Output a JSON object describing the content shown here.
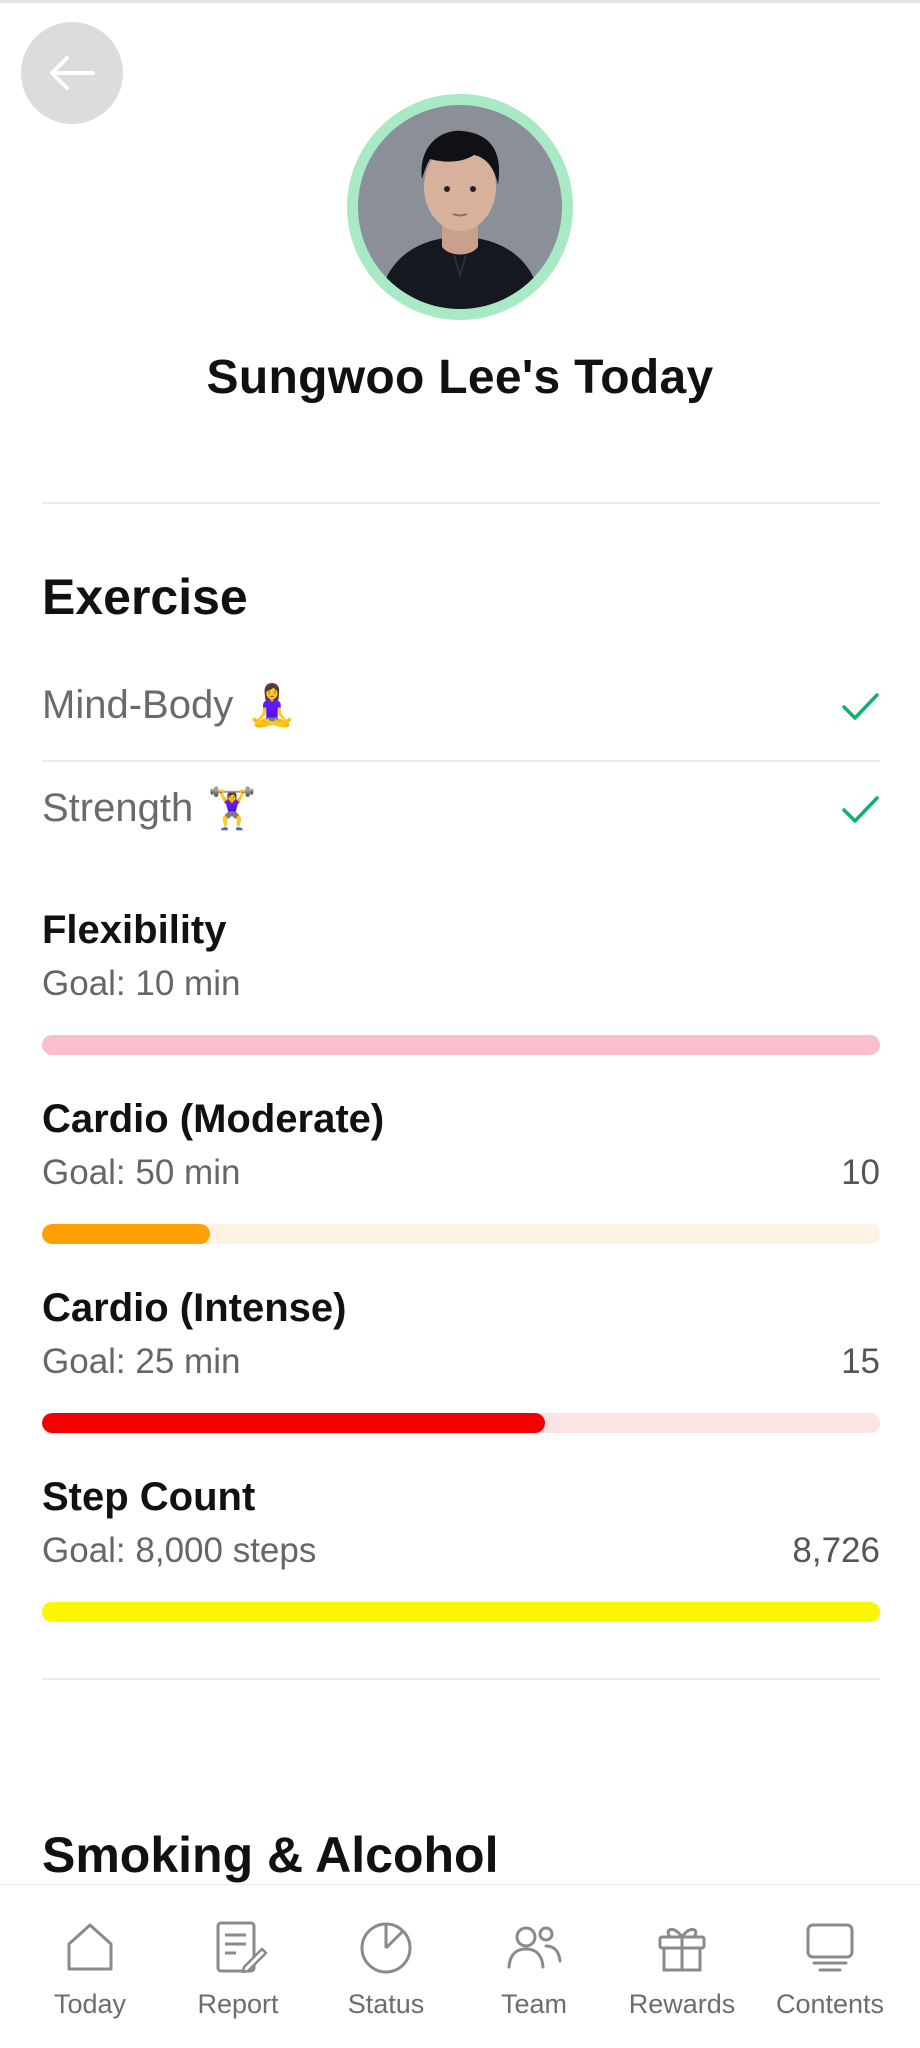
{
  "profile": {
    "title": "Sungwoo Lee's Today"
  },
  "exercise": {
    "section_title": "Exercise",
    "checks": [
      {
        "label": "Mind-Body",
        "emoji": "🧘‍♀️",
        "done": true
      },
      {
        "label": "Strength",
        "emoji": "🏋️‍♀️",
        "done": true
      }
    ],
    "metrics": [
      {
        "name": "Flexibility",
        "goal": "Goal: 10 min",
        "value": "",
        "progress": 0,
        "fill_color": "#f7b7c7",
        "track_color": "#f9bfcd"
      },
      {
        "name": "Cardio (Moderate)",
        "goal": "Goal: 50 min",
        "value": "10",
        "progress": 0.2,
        "fill_color": "#ff9f00",
        "track_color": "#fdf2e3"
      },
      {
        "name": "Cardio (Intense)",
        "goal": "Goal: 25 min",
        "value": "15",
        "progress": 0.6,
        "fill_color": "#f40000",
        "track_color": "#fde3e3"
      },
      {
        "name": "Step Count",
        "goal": "Goal: 8,000 steps",
        "value": "8,726",
        "progress": 1.0,
        "fill_color": "#fbf700",
        "track_color": "#fbf700"
      }
    ]
  },
  "smoking": {
    "section_title": "Smoking & Alcohol"
  },
  "nav": {
    "items": [
      {
        "label": "Today",
        "icon": "home-icon"
      },
      {
        "label": "Report",
        "icon": "report-icon"
      },
      {
        "label": "Status",
        "icon": "pie-chart-icon"
      },
      {
        "label": "Team",
        "icon": "team-icon"
      },
      {
        "label": "Rewards",
        "icon": "gift-icon"
      },
      {
        "label": "Contents",
        "icon": "contents-icon"
      }
    ]
  },
  "colors": {
    "check": "#10b26b",
    "avatar_ring": "#a9e9c5"
  }
}
